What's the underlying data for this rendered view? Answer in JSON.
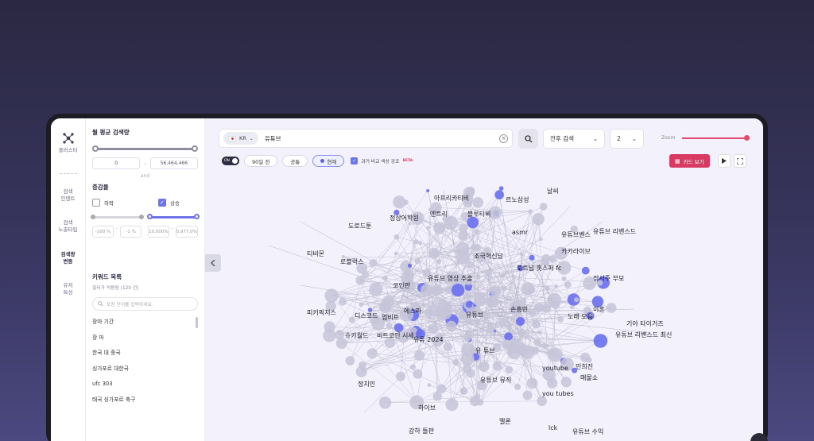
{
  "nav": {
    "items": [
      {
        "label": "클러스터",
        "active": false
      },
      {
        "label": "검색\n인텐트",
        "active": false
      },
      {
        "label": "검색\n노출타입",
        "active": false
      },
      {
        "label": "검색량\n변동",
        "active": true
      },
      {
        "label": "유저\n특성",
        "active": false
      }
    ]
  },
  "filter": {
    "volume_title": "월 평균 검색량",
    "volume_min": "0",
    "volume_max": "56,464,466",
    "and_text": "and",
    "change_title": "증감율",
    "decrease_label": "하락",
    "increase_label": "상승",
    "decrease_checked": false,
    "increase_checked": true,
    "dec_min": "-100",
    "dec_max": "-1",
    "inc_min": "10,000%",
    "inc_max": "5,977,0%",
    "pct": "%"
  },
  "keywords": {
    "title": "키워드 목록",
    "subtitle": "필터가 적용됨 (120 건)",
    "search_placeholder": "포함 단어를 입력하세요.",
    "items": [
      "장마 기간",
      "장 마",
      "한국 대 중국",
      "싱가포르 대한국",
      "ufc 303",
      "태국 싱가포르 축구"
    ]
  },
  "search": {
    "country": "KR",
    "query": "유튜브",
    "mode": "전후 검색",
    "depth": "2"
  },
  "zoom": {
    "label": "Zoom",
    "level": 1.0
  },
  "controls": {
    "toggle": "ON",
    "range_90": "90일 전",
    "common": "공통",
    "current": "현재",
    "past_highlight": "과거 비교 색상 강조",
    "beta": "BETA",
    "card_view": "카드 보기"
  },
  "graph_labels": [
    "날씨",
    "아프리카티비",
    "르노삼성",
    "정상어학원",
    "엔트리",
    "블루티비",
    "도로드툰",
    "asmr",
    "유튜브벤스",
    "유튜브 리밴스드",
    "카카라이브",
    "티비몬",
    "로블럭스",
    "조국혁신당",
    "토트넘 홋스퍼 fc",
    "유튜브 영상 추출",
    "정서주 부모",
    "코인판",
    "피키픽처스",
    "디스코드",
    "에스파",
    "업비트",
    "유튜브",
    "손흥민",
    "이혼",
    "노래 모음",
    "기아 타이거즈",
    "유튜브 리밴스드 최신",
    "슈카월드",
    "비트코인 시세",
    "유튜 2024",
    "유 튜브",
    "민희진",
    "youtube",
    "you tubes",
    "매물쇼",
    "유튜브 뮤직",
    "정치인",
    "하이브",
    "강하 들판",
    "멜론",
    "lck",
    "유튜브 수익"
  ],
  "colors": {
    "accent": "#5f63e6",
    "brand": "#d93a62",
    "node": "#c6c4d8",
    "highlight": "#6a6ff0"
  }
}
